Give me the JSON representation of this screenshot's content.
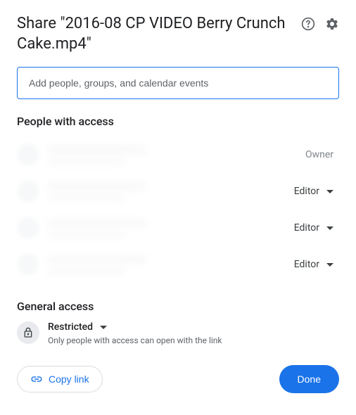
{
  "header": {
    "title": "Share \"2016-08 CP VIDEO Berry Crunch Cake.mp4\""
  },
  "input": {
    "placeholder": "Add people, groups, and calendar events"
  },
  "sections": {
    "people_title": "People with access",
    "general_title": "General access"
  },
  "people": [
    {
      "role": "Owner",
      "is_owner": true
    },
    {
      "role": "Editor",
      "is_owner": false
    },
    {
      "role": "Editor",
      "is_owner": false
    },
    {
      "role": "Editor",
      "is_owner": false
    }
  ],
  "access": {
    "level": "Restricted",
    "description": "Only people with access can open with the link"
  },
  "buttons": {
    "copy_link": "Copy link",
    "done": "Done"
  }
}
